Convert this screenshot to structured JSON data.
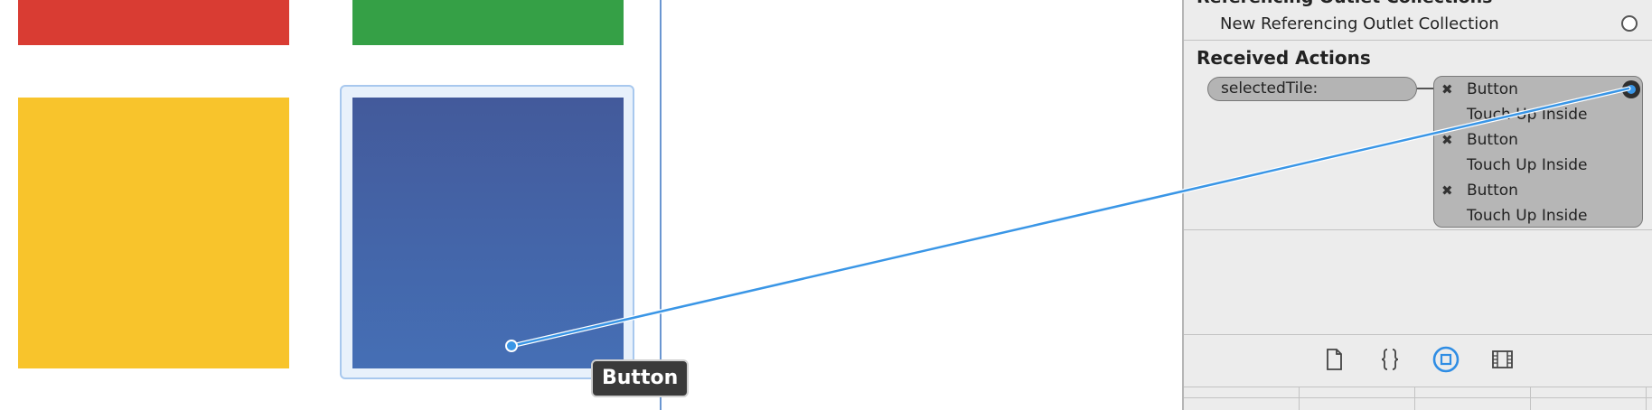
{
  "colors": {
    "red_tile": "#d93c33",
    "green_tile": "#35a046",
    "yellow_tile": "#f8c42c",
    "blue_tile": "#4465aa",
    "connection": "#3a96e6"
  },
  "canvas": {
    "tooltip_label": "Button"
  },
  "inspector": {
    "referencing_outlet_collections_header": "Referencing Outlet Collections",
    "new_referencing_outlet_collection": "New Referencing Outlet Collection",
    "received_actions_header": "Received Actions",
    "action_name": "selectedTile:",
    "connections": [
      {
        "source": "Button",
        "event": "Touch Up Inside"
      },
      {
        "source": "Button",
        "event": "Touch Up Inside"
      },
      {
        "source": "Button",
        "event": "Touch Up Inside"
      }
    ],
    "remove_glyph": "✖"
  },
  "toolbar": {
    "icons": [
      "file-icon",
      "braces-icon",
      "object-icon",
      "library-icon"
    ],
    "selected": "object-icon"
  }
}
